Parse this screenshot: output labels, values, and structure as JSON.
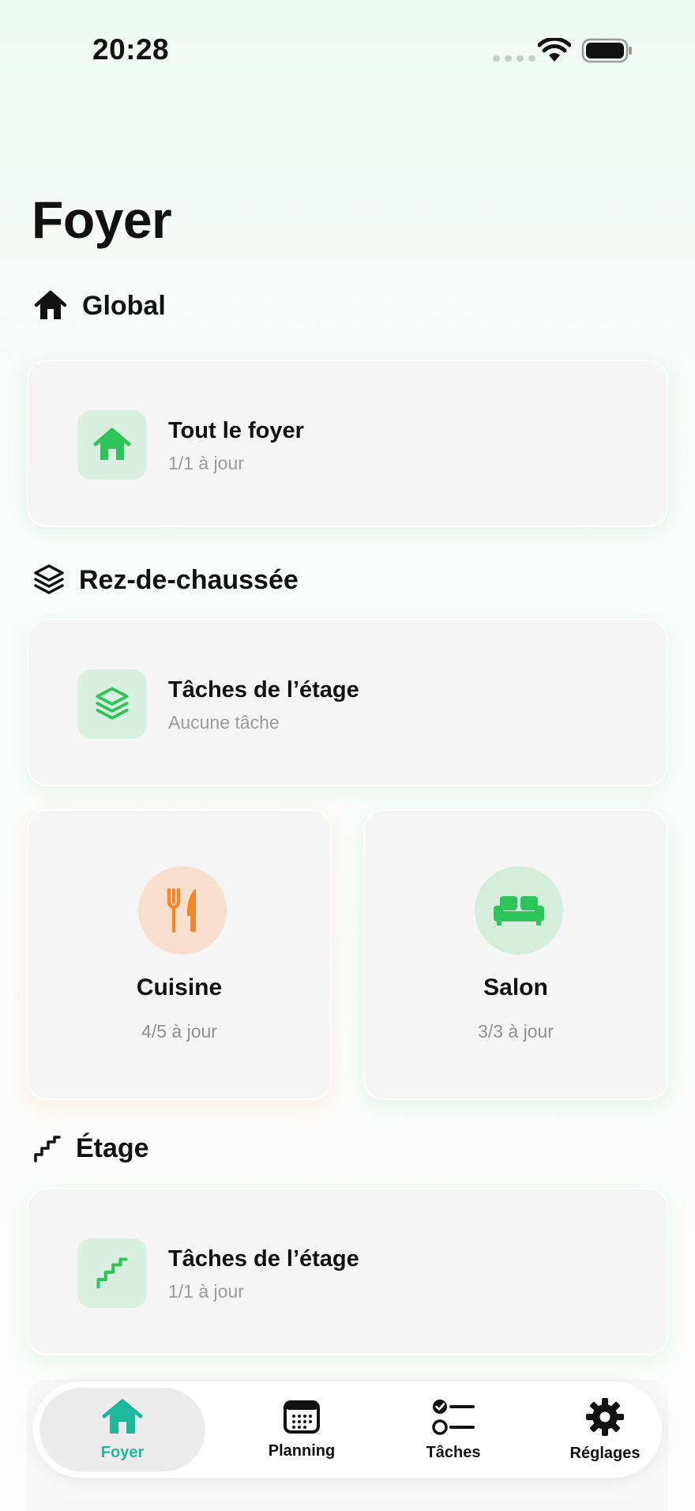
{
  "status_bar": {
    "time": "20:28"
  },
  "page_title": "Foyer",
  "sections": {
    "global": {
      "label": "Global"
    },
    "ground": {
      "label": "Rez-de-chaussée"
    },
    "upstairs": {
      "label": "Étage"
    }
  },
  "cards": {
    "whole_home": {
      "title": "Tout le foyer",
      "subtitle": "1/1 à jour"
    },
    "ground_floor_tasks": {
      "title": "Tâches de l’étage",
      "subtitle": "Aucune tâche"
    },
    "upstairs_tasks": {
      "title": "Tâches de l’étage",
      "subtitle": "1/1 à jour"
    }
  },
  "rooms": [
    {
      "name": "Cuisine",
      "status": "4/5 à jour",
      "icon": "fork-knife-icon",
      "color": "#f5872a"
    },
    {
      "name": "Salon",
      "status": "3/3 à jour",
      "icon": "sofa-icon",
      "color": "#2fc45a"
    }
  ],
  "tab_bar": {
    "items": [
      {
        "label": "Foyer",
        "icon": "house-icon",
        "active": true
      },
      {
        "label": "Planning",
        "icon": "calendar-icon",
        "active": false
      },
      {
        "label": "Tâches",
        "icon": "checklist-icon",
        "active": false
      },
      {
        "label": "Réglages",
        "icon": "gear-icon",
        "active": false
      }
    ]
  },
  "colors": {
    "accent_green": "#2fc45a",
    "accent_teal": "#1fb89c",
    "accent_orange": "#f5872a"
  }
}
